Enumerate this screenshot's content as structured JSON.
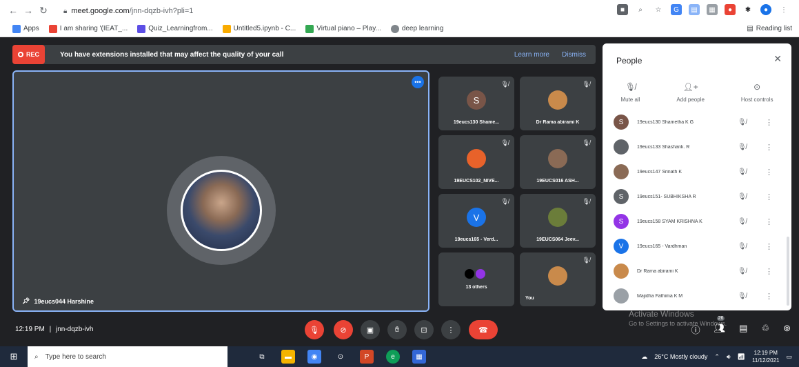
{
  "browser": {
    "url_host": "meet.google.com",
    "url_path": "/jnn-dqzb-ivh?pli=1",
    "bookmarks": [
      {
        "label": "Apps",
        "color": "#4285f4"
      },
      {
        "label": "I am sharing '(IEAT_...",
        "color": "#ea4335"
      },
      {
        "label": "Quiz_Learningfrom...",
        "color": "#5c4ee5"
      },
      {
        "label": "Untitled5.ipynb - C...",
        "color": "#f9ab00"
      },
      {
        "label": "Virtual piano – Play...",
        "color": "#34a853"
      },
      {
        "label": "deep learning",
        "color": "#80868b"
      }
    ],
    "reading_list": "Reading list"
  },
  "banner": {
    "rec": "REC",
    "text": "You have extensions installed that may affect the quality of your call",
    "learn_more": "Learn more",
    "dismiss": "Dismiss"
  },
  "main_tile": {
    "name": "19eucs044 Harshine"
  },
  "tiles": [
    {
      "name": "19eucs130 Shame...",
      "initial": "S",
      "color": "#795548"
    },
    {
      "name": "Dr Rama abirami K",
      "initial": "",
      "color": "#c98a4b"
    },
    {
      "name": "19EUCS102_NIVE...",
      "initial": "",
      "color": "#e8622a"
    },
    {
      "name": "19EUCS016 ASH...",
      "initial": "",
      "color": "#8a6a55"
    },
    {
      "name": "19eucs165 - Verd...",
      "initial": "V",
      "color": "#1a73e8"
    },
    {
      "name": "19EUCS064 Jeev...",
      "initial": "",
      "color": "#6b7d3a"
    },
    {
      "name": "13 others",
      "initial": "",
      "color": "#202124"
    },
    {
      "name": "You",
      "initial": "",
      "color": "#c98a4b"
    }
  ],
  "meeting": {
    "time": "12:19 PM",
    "code": "jnn-dqzb-ivh"
  },
  "people": {
    "title": "People",
    "actions": [
      "Mute all",
      "Add people",
      "Host controls"
    ],
    "list": [
      {
        "name": "19eucs130 Shametha K G",
        "initial": "S",
        "color": "#795548"
      },
      {
        "name": "19eucs133 Shashank. R",
        "initial": "",
        "color": "#5f6368"
      },
      {
        "name": "19eucs147 Srinath K",
        "initial": "",
        "color": "#8a6a55"
      },
      {
        "name": "19eucs151- SUBHIKSHA R",
        "initial": "S",
        "color": "#5f6368"
      },
      {
        "name": "19eucs158 SYAM KRISHNA K",
        "initial": "S",
        "color": "#9334e6"
      },
      {
        "name": "19eucs165 - Vardhman",
        "initial": "V",
        "color": "#1a73e8"
      },
      {
        "name": "Dr Rama abirami K",
        "initial": "",
        "color": "#c98a4b"
      },
      {
        "name": "Majidha Fathima K M",
        "initial": "",
        "color": "#9aa0a6"
      }
    ]
  },
  "watermark": {
    "title": "Activate Windows",
    "sub": "Go to Settings to activate Windows."
  },
  "taskbar": {
    "search_placeholder": "Type here to search",
    "weather": "26°C  Mostly cloudy",
    "time": "12:19 PM",
    "date": "11/12/2021",
    "chat_count": "26"
  }
}
